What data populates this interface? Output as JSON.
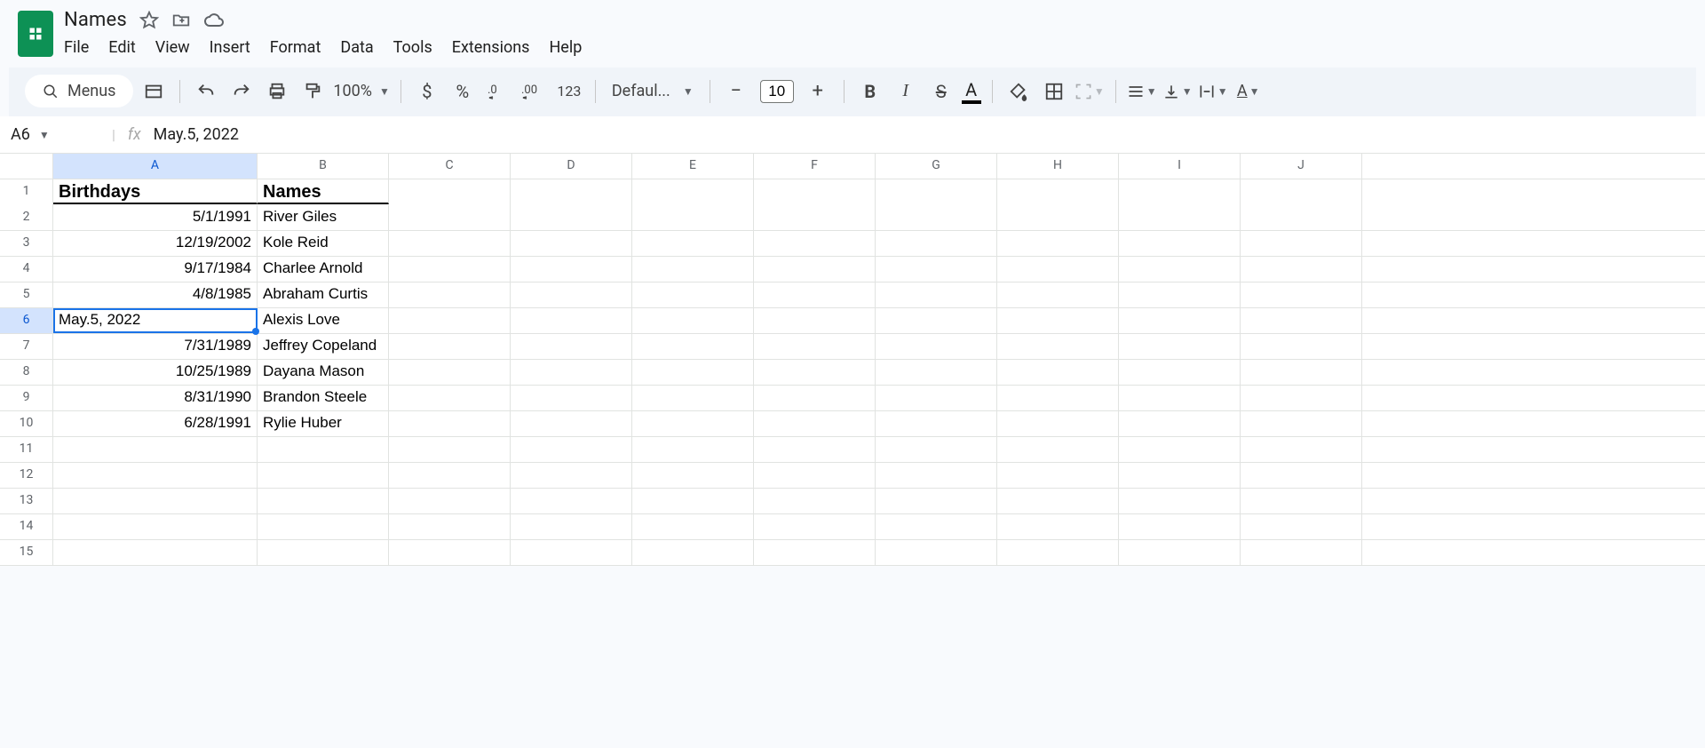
{
  "doc_title": "Names",
  "menus_label": "Menus",
  "menu": {
    "file": "File",
    "edit": "Edit",
    "view": "View",
    "insert": "Insert",
    "format": "Format",
    "data": "Data",
    "tools": "Tools",
    "extensions": "Extensions",
    "help": "Help"
  },
  "toolbar": {
    "zoom": "100%",
    "font_name": "Defaul...",
    "font_size": "10",
    "number_format_123": "123"
  },
  "name_box": "A6",
  "formula_bar": "May.5, 2022",
  "columns": [
    "A",
    "B",
    "C",
    "D",
    "E",
    "F",
    "G",
    "H",
    "I",
    "J"
  ],
  "selected_column": "A",
  "selected_row": 6,
  "rows_visible": 15,
  "headers": {
    "A": "Birthdays",
    "B": "Names"
  },
  "data_rows": [
    {
      "birthday": "5/1/1991",
      "name": "River Giles"
    },
    {
      "birthday": "12/19/2002",
      "name": "Kole Reid"
    },
    {
      "birthday": "9/17/1984",
      "name": "Charlee Arnold"
    },
    {
      "birthday": "4/8/1985",
      "name": "Abraham Curtis"
    },
    {
      "birthday": "May.5, 2022",
      "name": "Alexis Love"
    },
    {
      "birthday": "7/31/1989",
      "name": "Jeffrey Copeland"
    },
    {
      "birthday": "10/25/1989",
      "name": "Dayana Mason"
    },
    {
      "birthday": "8/31/1990",
      "name": "Brandon Steele"
    },
    {
      "birthday": "6/28/1991",
      "name": "Rylie Huber"
    }
  ]
}
